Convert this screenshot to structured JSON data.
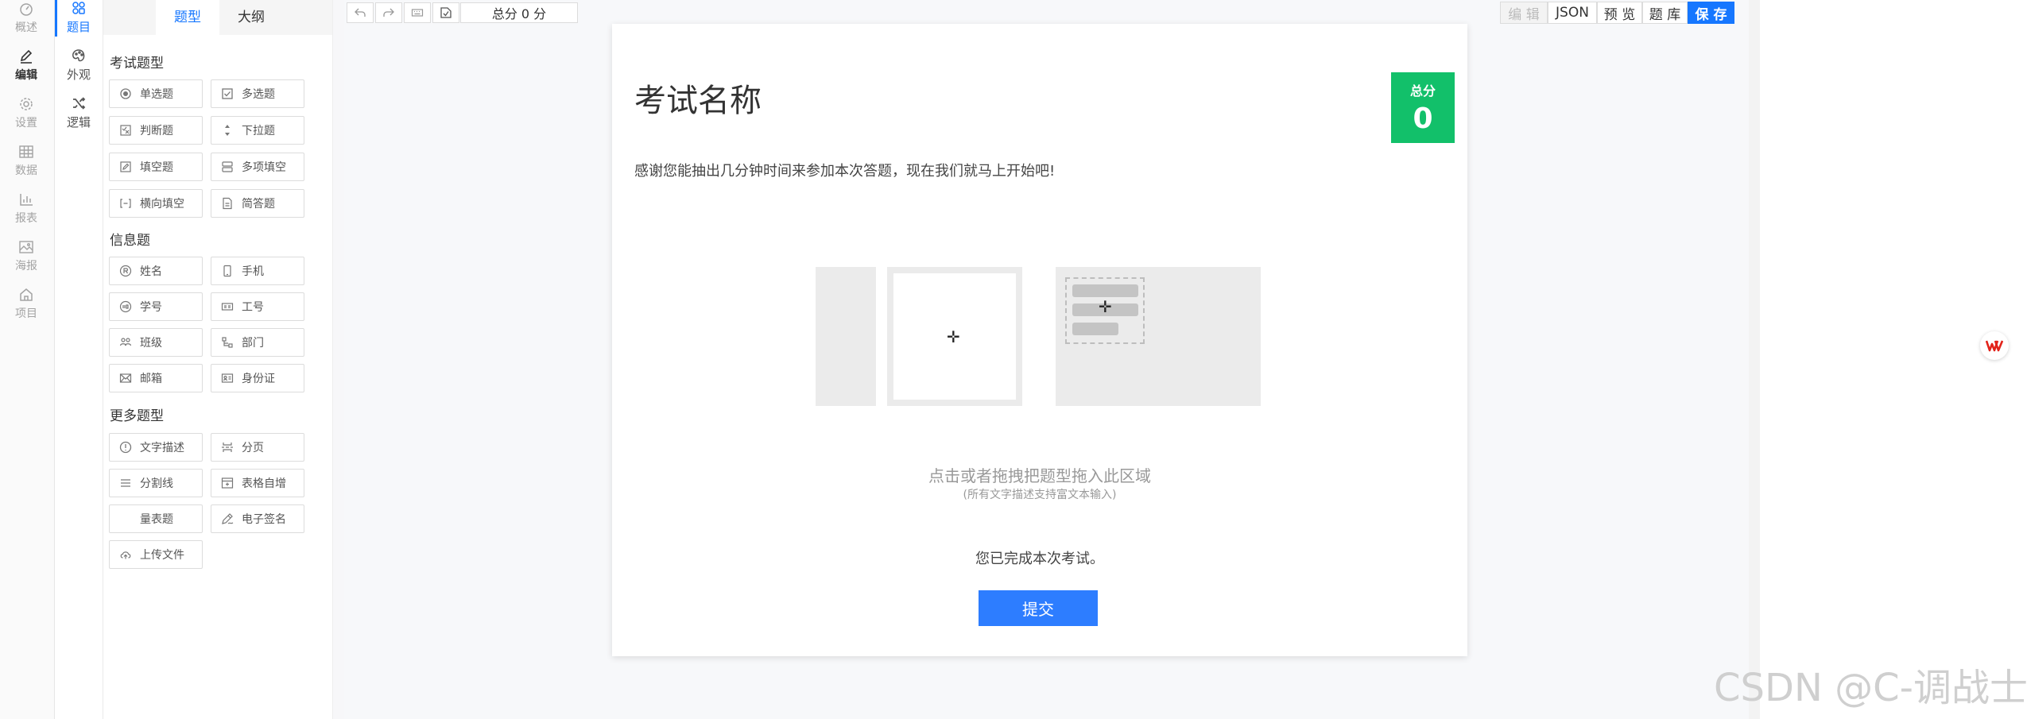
{
  "nav_primary": [
    {
      "label": "概述",
      "icon": "dashboard-icon"
    },
    {
      "label": "编辑",
      "icon": "pen-icon",
      "active": true
    },
    {
      "label": "设置",
      "icon": "gear-icon"
    },
    {
      "label": "数据",
      "icon": "table-icon"
    },
    {
      "label": "报表",
      "icon": "bar-chart-icon"
    },
    {
      "label": "海报",
      "icon": "image-icon"
    },
    {
      "label": "项目",
      "icon": "home-icon"
    }
  ],
  "nav_secondary": [
    {
      "label": "题目",
      "icon": "grid-icon",
      "active": true
    },
    {
      "label": "外观",
      "icon": "palette-icon"
    },
    {
      "label": "逻辑",
      "icon": "shuffle-icon"
    }
  ],
  "panel": {
    "tabs": [
      {
        "label": "题型",
        "active": true
      },
      {
        "label": "大纲"
      }
    ],
    "groups": {
      "exam": {
        "title": "考试题型",
        "items": [
          "单选题",
          "多选题",
          "判断题",
          "下拉题",
          "填空题",
          "多项填空",
          "横向填空",
          "简答题"
        ]
      },
      "info": {
        "title": "信息题",
        "items": [
          "姓名",
          "手机",
          "学号",
          "工号",
          "班级",
          "部门",
          "邮箱",
          "身份证"
        ]
      },
      "more": {
        "title": "更多题型",
        "items": [
          "文字描述",
          "分页",
          "分割线",
          "表格自增",
          "量表题",
          "电子签名",
          "上传文件"
        ]
      }
    }
  },
  "toolbar": {
    "total_score": "总分 0 分",
    "right_buttons": [
      "编 辑",
      "JSON",
      "预 览",
      "题 库",
      "保 存"
    ]
  },
  "paper": {
    "title": "考试名称",
    "score_label": "总分",
    "score_value": "0",
    "intro": "感谢您能抽出几分钟时间来参加本次答题，现在我们就马上开始吧!",
    "drop_hint": "点击或者拖拽把题型拖入此区域",
    "drop_sub": "(所有文字描述支持富文本输入)",
    "finish_text": "您已完成本次考试。",
    "submit_label": "提交"
  },
  "watermark": "CSDN @C-调战士",
  "colors": {
    "primary": "#1677ff",
    "score_green": "#12c06a",
    "submit_blue": "#2d7dff"
  }
}
